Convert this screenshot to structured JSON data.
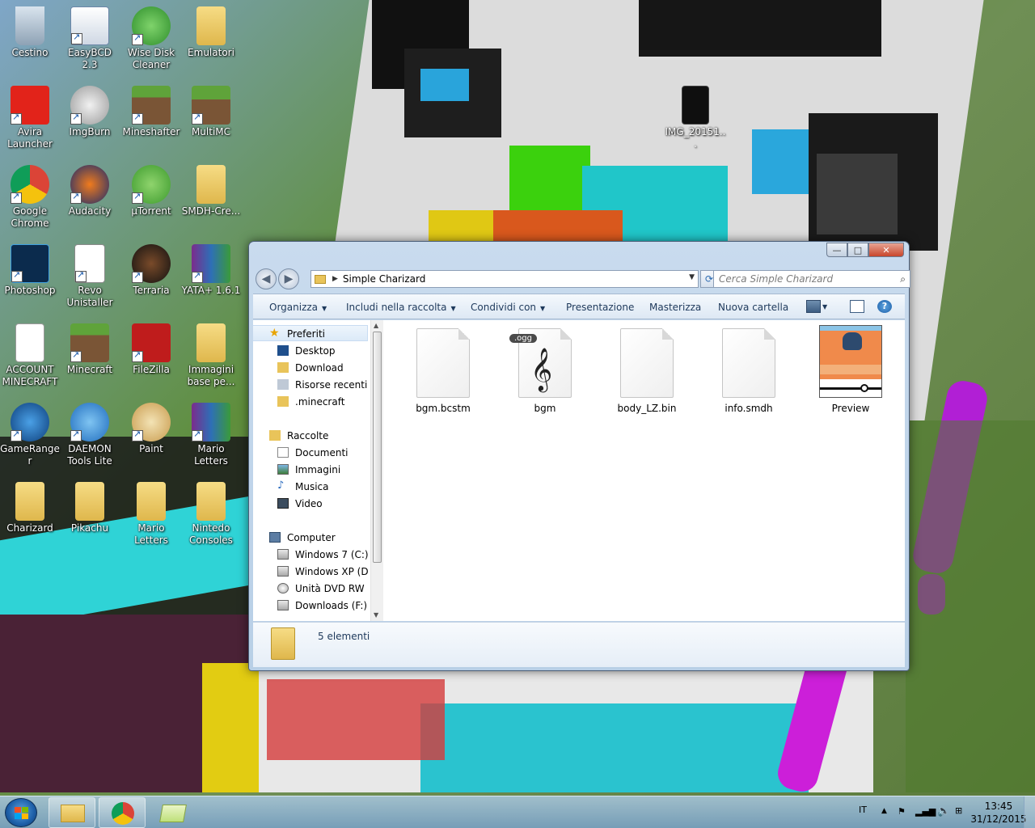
{
  "desktop": {
    "icons": [
      {
        "label": "Cestino"
      },
      {
        "label": "EasyBCD 2.3"
      },
      {
        "label": "Wise Disk Cleaner"
      },
      {
        "label": "Emulatori"
      },
      {
        "label": "Avira Launcher"
      },
      {
        "label": "ImgBurn"
      },
      {
        "label": "Mineshafter"
      },
      {
        "label": "MultiMC"
      },
      {
        "label": "Google Chrome"
      },
      {
        "label": "Audacity"
      },
      {
        "label": "µTorrent"
      },
      {
        "label": "SMDH-Cre..."
      },
      {
        "label": "Photoshop"
      },
      {
        "label": "Revo Unistaller"
      },
      {
        "label": "Terraria"
      },
      {
        "label": "YATA+ 1.6.1"
      },
      {
        "label": "ACCOUNT MINECRAFT"
      },
      {
        "label": "Minecraft"
      },
      {
        "label": "FileZilla"
      },
      {
        "label": "Immagini base pe..."
      },
      {
        "label": "GameRanger"
      },
      {
        "label": "DAEMON Tools Lite"
      },
      {
        "label": "Paint"
      },
      {
        "label": "Mario Letters"
      },
      {
        "label": "Charizard"
      },
      {
        "label": "Pikachu"
      },
      {
        "label": "Mario Letters"
      },
      {
        "label": "Nintedo Consoles"
      },
      {
        "label": "IMG_20151..."
      }
    ]
  },
  "window": {
    "title": "Simple Charizard",
    "controls": {
      "minimize": "—",
      "maximize": "□",
      "close": "✕"
    },
    "address": {
      "crumb": "Simple Charizard"
    },
    "search": {
      "placeholder": "Cerca Simple Charizard"
    },
    "toolbar": {
      "organize": "Organizza",
      "include": "Includi nella raccolta",
      "share": "Condividi con",
      "slideshow": "Presentazione",
      "burn": "Masterizza",
      "new_folder": "Nuova cartella"
    },
    "nav": {
      "favorites": "Preferiti",
      "desktop": "Desktop",
      "download": "Download",
      "recent": "Risorse recenti",
      "minecraft": ".minecraft",
      "libraries": "Raccolte",
      "documents": "Documenti",
      "pictures": "Immagini",
      "music": "Musica",
      "video": "Video",
      "computer": "Computer",
      "drive_c": "Windows 7 (C:)",
      "drive_d": "Windows XP (D:)",
      "drive_e": "Unità DVD RW (E",
      "drive_f": "Downloads (F:)"
    },
    "files": [
      {
        "name": "bgm.bcstm",
        "type": "blank"
      },
      {
        "name": "bgm",
        "type": "audio",
        "badge": ".ogg"
      },
      {
        "name": "body_LZ.bin",
        "type": "blank"
      },
      {
        "name": "info.smdh",
        "type": "blank"
      },
      {
        "name": "Preview",
        "type": "image"
      }
    ],
    "details": {
      "count": "5 elementi"
    }
  },
  "taskbar": {
    "apps": [
      "Esplora risorse",
      "Google Chrome",
      "Cartella"
    ],
    "tray": {
      "lang": "IT",
      "time": "13:45",
      "date": "31/12/2015"
    }
  }
}
